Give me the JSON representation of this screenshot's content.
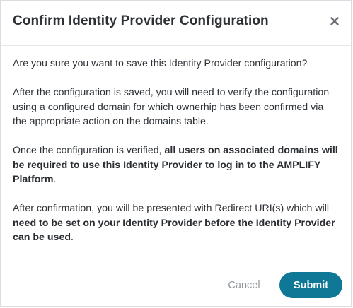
{
  "dialog": {
    "title": "Confirm Identity Provider Configuration",
    "close_icon": "close-icon"
  },
  "body": {
    "p1": "Are you sure you want to save this Identity Provider configuration?",
    "p2": "After the configuration is saved, you will need to verify the configuration using a configured domain for which ownerhip has been confirmed via the appropriate action on the domains table.",
    "p3_prefix": "Once the configuration is verified, ",
    "p3_bold": "all users on associated domains will be required to use this Identity Provider to log in to the AMPLIFY Platform",
    "p3_suffix": ".",
    "p4_prefix": "After confirmation, you will be presented with Redirect URI(s) which will ",
    "p4_bold": "need to be set on your Identity Provider before the Identity Provider can be used",
    "p4_suffix": "."
  },
  "footer": {
    "cancel_label": "Cancel",
    "submit_label": "Submit"
  },
  "colors": {
    "primary": "#0f7896",
    "cancel_text": "#8f959b",
    "border": "#e5e7ea"
  }
}
